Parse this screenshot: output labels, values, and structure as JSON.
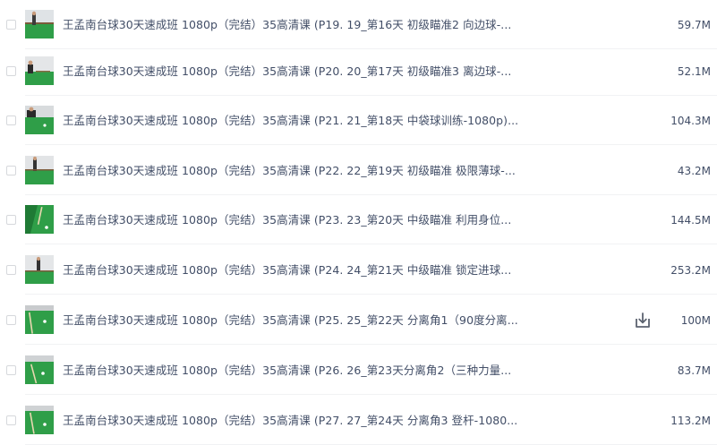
{
  "files": [
    {
      "name": "王孟南台球30天速成班 1080p（完结）35高清课 (P19. 19_第16天 初级瞄准2 向边球-...",
      "size": "59.7M",
      "thumb_icon": "billiards-video-thumbnail-icon"
    },
    {
      "name": "王孟南台球30天速成班 1080p（完结）35高清课 (P20. 20_第17天 初级瞄准3 离边球-...",
      "size": "52.1M",
      "thumb_icon": "billiards-video-thumbnail-icon"
    },
    {
      "name": "王孟南台球30天速成班 1080p（完结）35高清课 (P21. 21_第18天 中袋球训练-1080p)...",
      "size": "104.3M",
      "thumb_icon": "billiards-video-thumbnail-icon"
    },
    {
      "name": "王孟南台球30天速成班 1080p（完结）35高清课 (P22. 22_第19天 初级瞄准 极限薄球-...",
      "size": "43.2M",
      "thumb_icon": "billiards-video-thumbnail-icon"
    },
    {
      "name": "王孟南台球30天速成班 1080p（完结）35高清课 (P23. 23_第20天 中级瞄准 利用身位...",
      "size": "144.5M",
      "thumb_icon": "billiards-video-thumbnail-icon"
    },
    {
      "name": "王孟南台球30天速成班 1080p（完结）35高清课 (P24. 24_第21天 中级瞄准 锁定进球...",
      "size": "253.2M",
      "thumb_icon": "billiards-video-thumbnail-icon"
    },
    {
      "name": "王孟南台球30天速成班 1080p（完结）35高清课 (P25. 25_第22天 分离角1（90度分离...",
      "size": "100M",
      "thumb_icon": "billiards-video-thumbnail-icon",
      "download_icon": "download-icon"
    },
    {
      "name": "王孟南台球30天速成班 1080p（完结）35高清课 (P26. 26_第23天分离角2（三种力量...",
      "size": "83.7M",
      "thumb_icon": "billiards-video-thumbnail-icon"
    },
    {
      "name": "王孟南台球30天速成班 1080p（完结）35高清课 (P27. 27_第24天 分离角3 登杆-1080...",
      "size": "113.2M",
      "thumb_icon": "billiards-video-thumbnail-icon"
    }
  ],
  "colors": {
    "text": "#424e67",
    "divider": "#f1f2f4",
    "table_green": "#2f9e48",
    "icon_gray": "#5c6370"
  }
}
